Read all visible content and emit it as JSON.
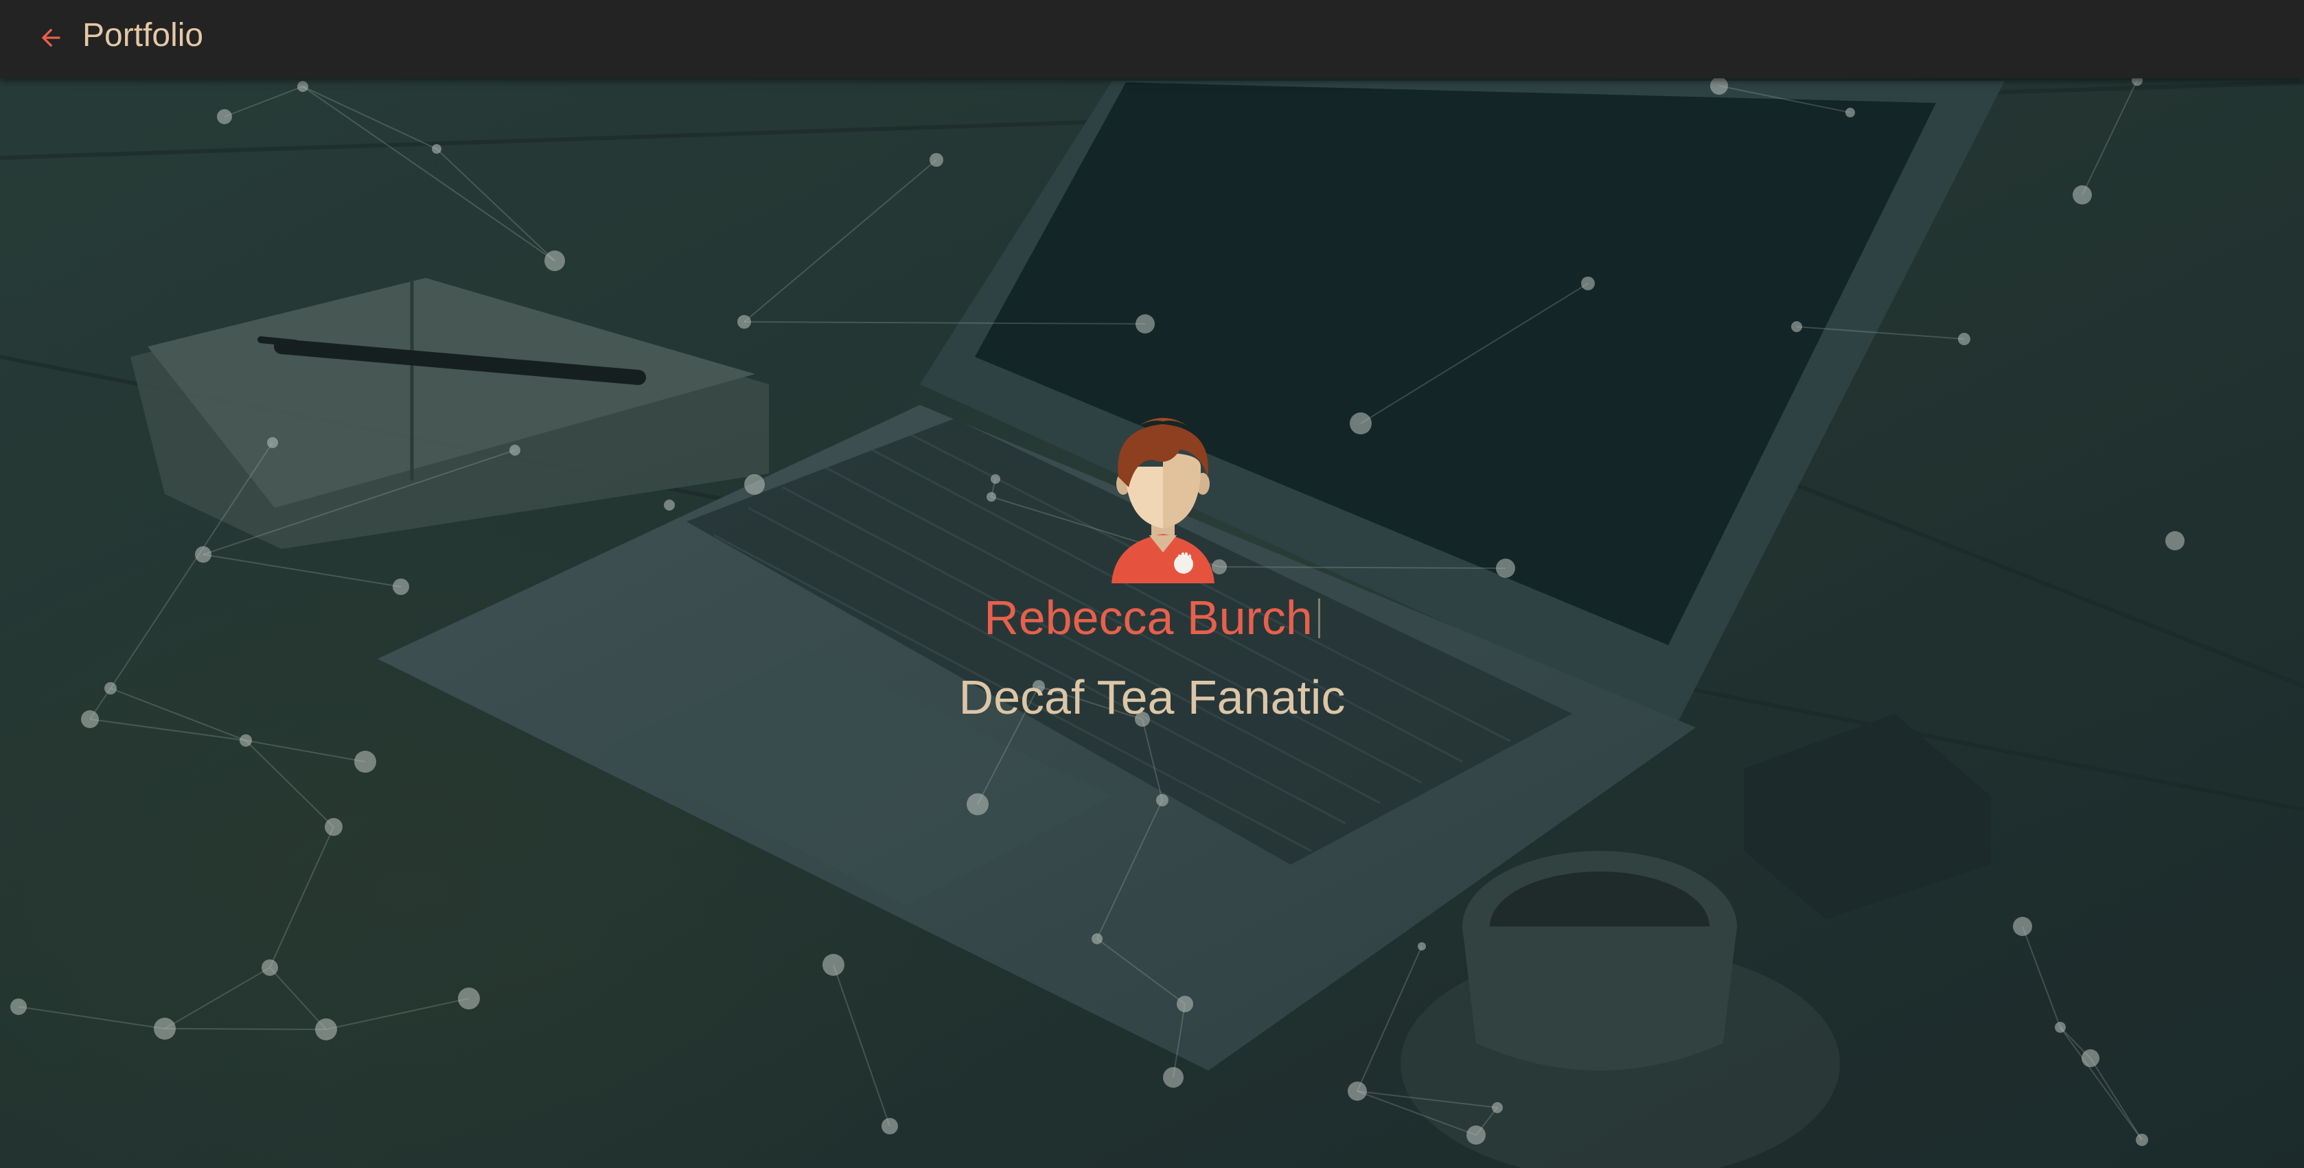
{
  "header": {
    "title": "Portfolio",
    "back_icon": "arrow-left-icon"
  },
  "profile": {
    "name": "Rebecca Burch",
    "tagline": "Decaf Tea Fanatic",
    "avatar_icon": "avatar-icon"
  },
  "colors": {
    "accent": "#e8604c",
    "title_text": "#e4c8a6",
    "topbar": "#232323",
    "background": "#1f3233"
  }
}
